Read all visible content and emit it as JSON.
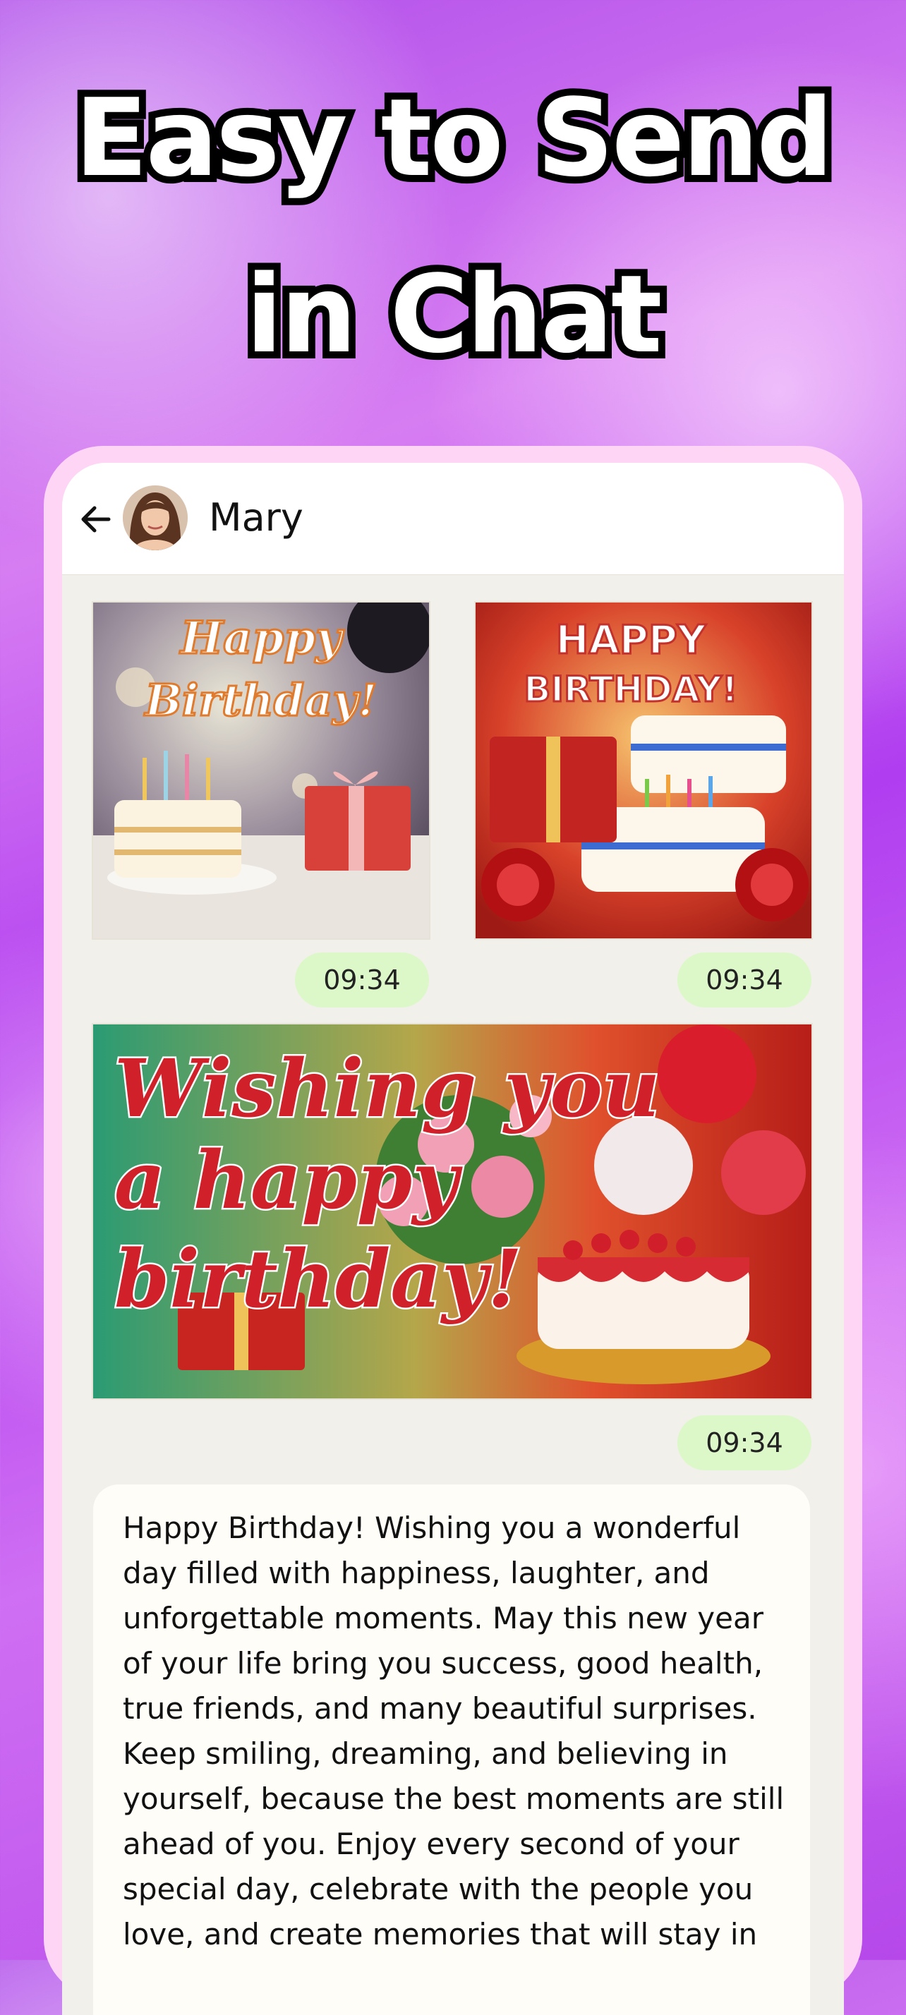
{
  "promo": {
    "headline_line1": "Easy to Send",
    "headline_line2": "in Chat"
  },
  "chat": {
    "contact_name": "Mary",
    "icons": {
      "back": "arrow-left-icon",
      "avatar": "contact-avatar"
    },
    "messages": [
      {
        "type": "image",
        "card_text_line1": "Happy",
        "card_text_line2": "Birthday!",
        "time": "09:34"
      },
      {
        "type": "image",
        "card_text_line1": "HAPPY",
        "card_text_line2": "BIRTHDAY!",
        "time": "09:34"
      },
      {
        "type": "image",
        "card_text_line1": "Wishing you",
        "card_text_line2": "a happy",
        "card_text_line3": "birthday!",
        "time": "09:34"
      },
      {
        "type": "text",
        "text": "Happy Birthday! Wishing you a wonderful day filled with happiness, laughter, and unforgettable moments. May this new year of your life bring you success, good health, true friends, and many beautiful surprises. Keep smiling, dreaming, and believing in yourself, because the best moments are still ahead of you. Enjoy every second of your special day, celebrate with the people you love, and create memories that will stay in"
      }
    ]
  },
  "colors": {
    "time_bubble": "#dcf8c9",
    "phone_frame": "#ffd5f6",
    "chat_background": "#f2f0ea"
  }
}
